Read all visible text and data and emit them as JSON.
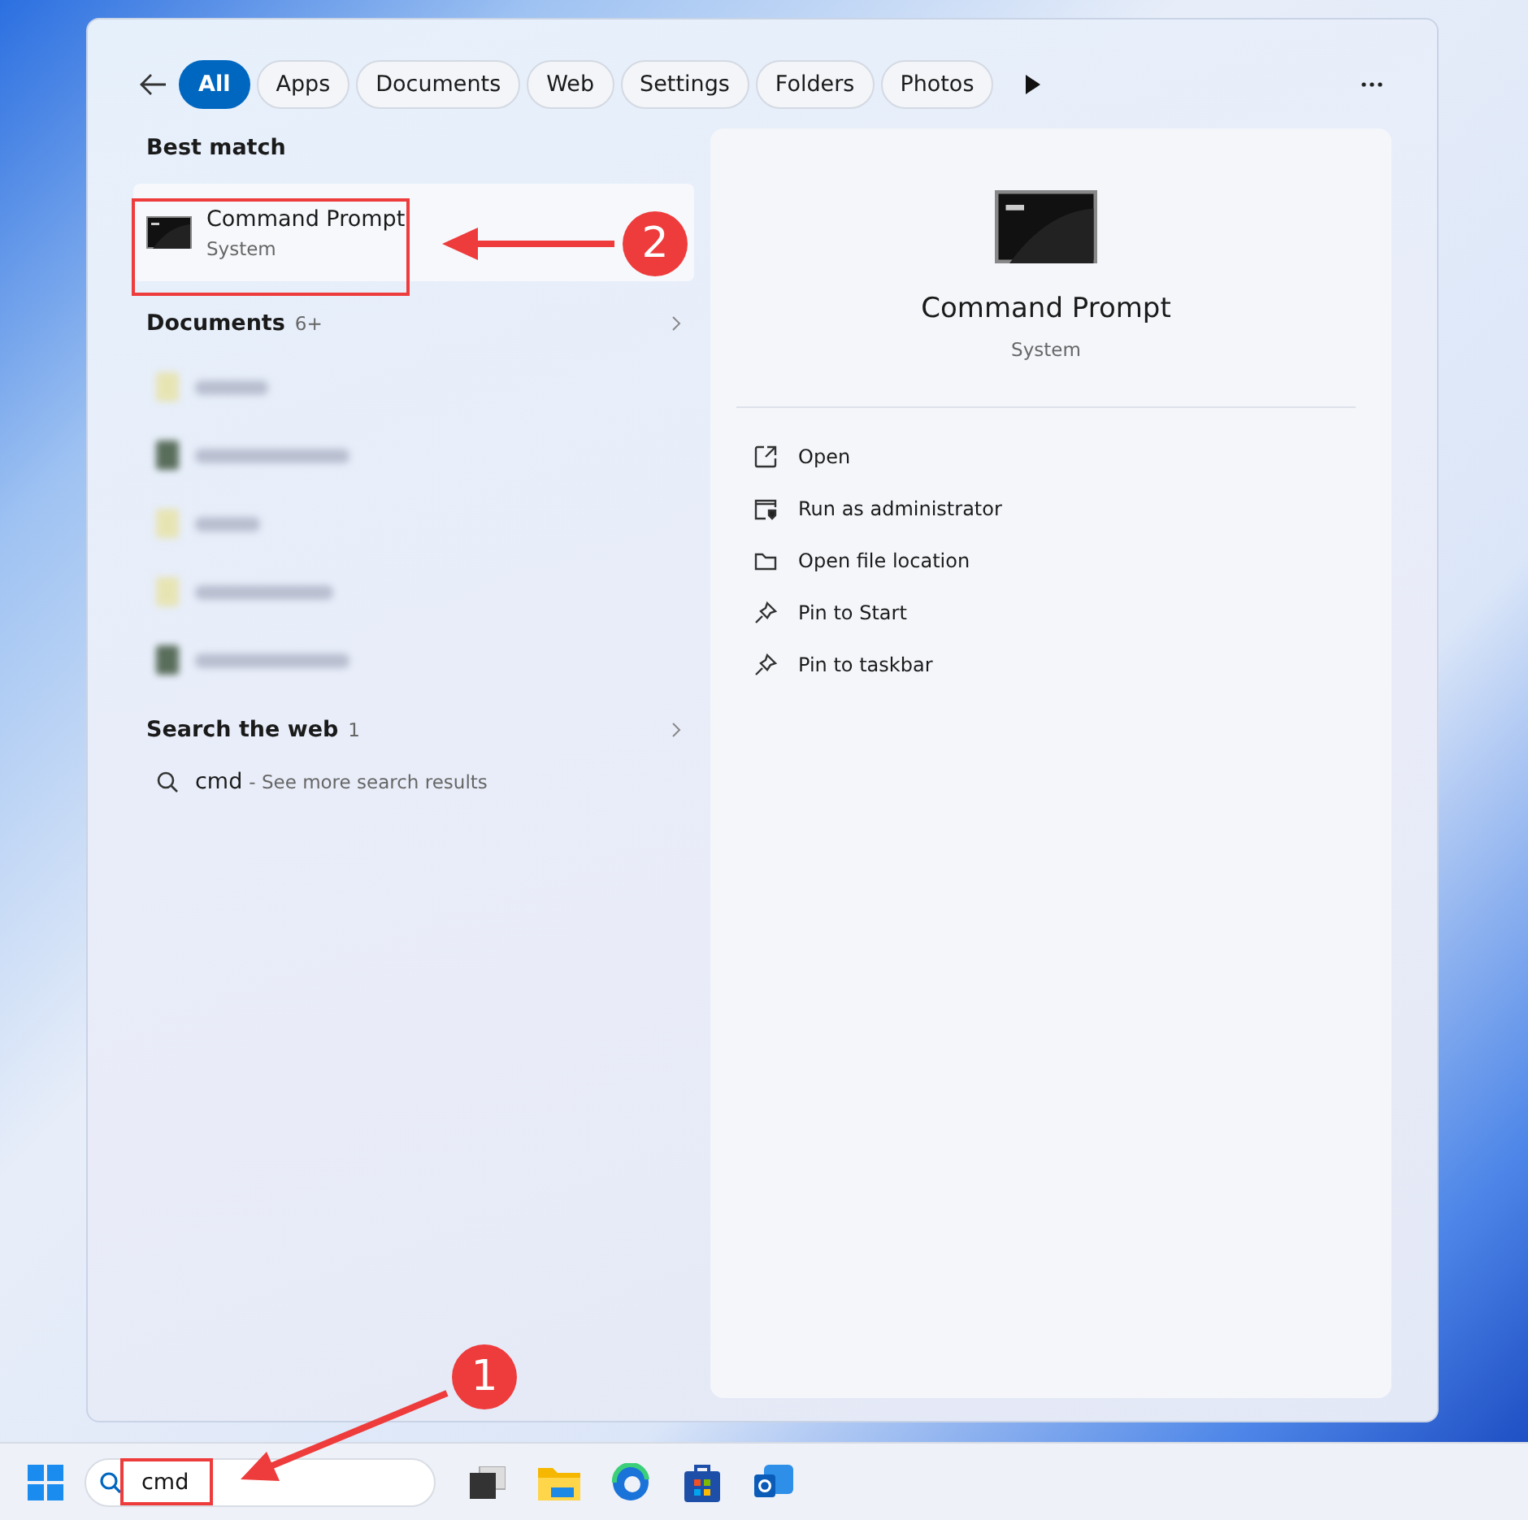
{
  "filters": [
    {
      "label": "All",
      "selected": true
    },
    {
      "label": "Apps",
      "selected": false
    },
    {
      "label": "Documents",
      "selected": false
    },
    {
      "label": "Web",
      "selected": false
    },
    {
      "label": "Settings",
      "selected": false
    },
    {
      "label": "Folders",
      "selected": false
    },
    {
      "label": "Photos",
      "selected": false
    }
  ],
  "best_match": {
    "heading": "Best match",
    "title": "Command Prompt",
    "subtitle": "System",
    "selected": true
  },
  "documents": {
    "heading": "Documents",
    "count": "6+",
    "items": [
      {
        "kind": "light"
      },
      {
        "kind": "dark"
      },
      {
        "kind": "light"
      },
      {
        "kind": "light"
      },
      {
        "kind": "dark"
      }
    ]
  },
  "web": {
    "heading": "Search the web",
    "count": "1",
    "query": "cmd",
    "hint": "- See more search results"
  },
  "detail": {
    "title": "Command Prompt",
    "subtitle": "System",
    "actions": [
      {
        "kind": "open",
        "label": "Open"
      },
      {
        "kind": "admin",
        "label": "Run as administrator"
      },
      {
        "kind": "folder",
        "label": "Open file location"
      },
      {
        "kind": "pin",
        "label": "Pin to Start"
      },
      {
        "kind": "pin",
        "label": "Pin to taskbar"
      }
    ]
  },
  "taskbar": {
    "search_value": "cmd"
  },
  "annotations": [
    {
      "number": "1"
    },
    {
      "number": "2"
    }
  ]
}
